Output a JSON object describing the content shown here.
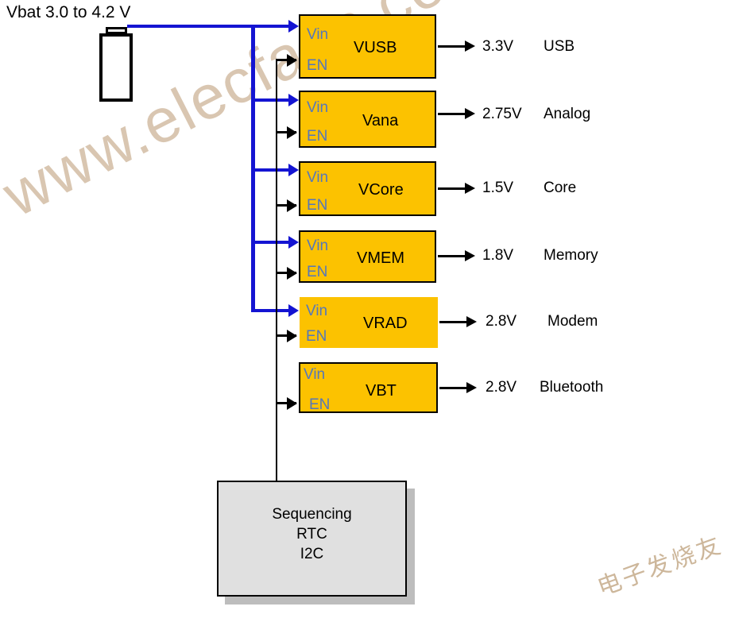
{
  "title": "Vbat 3.0 to 4.2 V",
  "labels": {
    "vin": "Vin",
    "en": "EN"
  },
  "battery": {
    "name": "battery-symbol"
  },
  "regulators": [
    {
      "name": "VUSB",
      "vin": "Vin",
      "en": "EN",
      "voltage": "3.3V",
      "rail": "USB"
    },
    {
      "name": "Vana",
      "vin": "Vin",
      "en": "EN",
      "voltage": "2.75V",
      "rail": "Analog"
    },
    {
      "name": "VCore",
      "vin": "Vin",
      "en": "EN",
      "voltage": "1.5V",
      "rail": "Core"
    },
    {
      "name": "VMEM",
      "vin": "Vin",
      "en": "EN",
      "voltage": "1.8V",
      "rail": "Memory"
    },
    {
      "name": "VRAD",
      "vin": "Vin",
      "en": "EN",
      "voltage": "2.8V",
      "rail": "Modem"
    },
    {
      "name": "VBT",
      "vin": "Vin",
      "en": "EN",
      "voltage": "2.8V",
      "rail": "Bluetooth"
    }
  ],
  "controller": {
    "line1": "Sequencing",
    "line2": "RTC",
    "line3": "I2C"
  },
  "watermarks": {
    "site": "www.elecfans.com",
    "chinese": "电子发烧友"
  },
  "colors": {
    "block_fill": "#fcc200",
    "power_bus": "#1414d2",
    "pin_label": "#5577bb",
    "controller_fill": "#e0e0e0",
    "watermark": "#d8c4ad"
  }
}
